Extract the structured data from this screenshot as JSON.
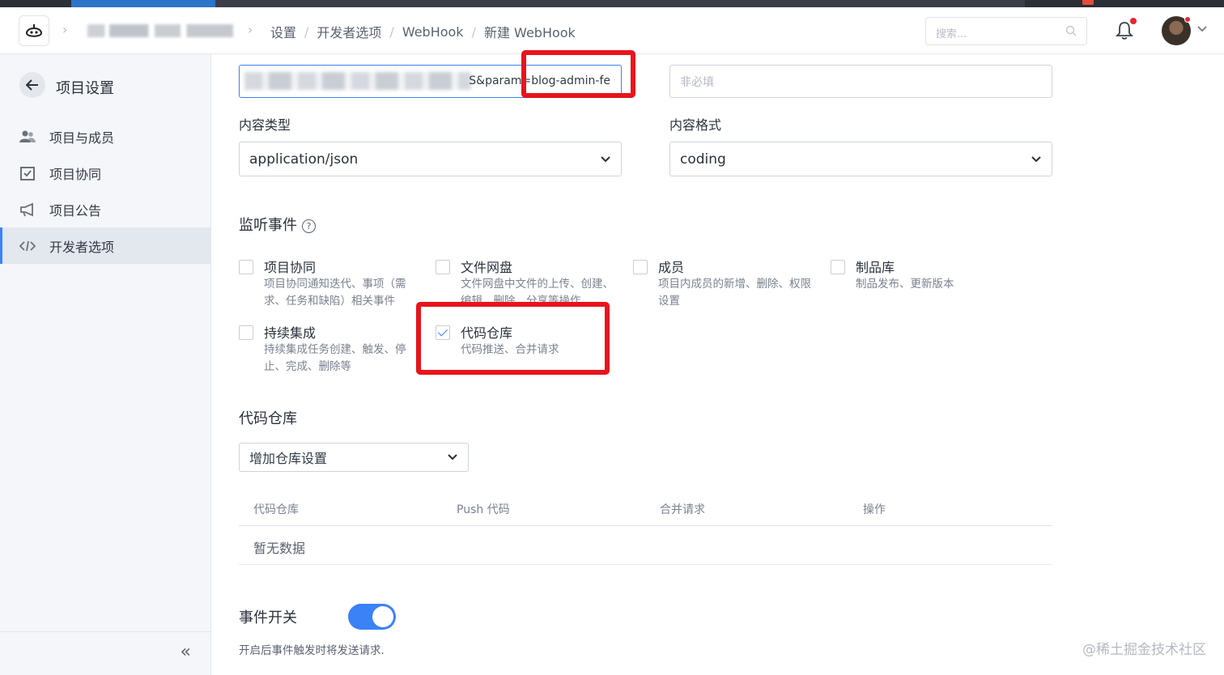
{
  "breadcrumb": [
    "设置",
    "开发者选项",
    "WebHook",
    "新建 WebHook"
  ],
  "header": {
    "search_placeholder": "搜索..."
  },
  "sidebar": {
    "title": "项目设置",
    "items": [
      {
        "label": "项目与成员",
        "icon": "members-icon",
        "active": false
      },
      {
        "label": "项目协同",
        "icon": "task-check-icon",
        "active": false
      },
      {
        "label": "项目公告",
        "icon": "megaphone-icon",
        "active": false
      },
      {
        "label": "开发者选项",
        "icon": "code-icon",
        "active": true
      }
    ],
    "collapse_label": "«"
  },
  "form": {
    "url_value_visible": "S&param=blog-admin-fe",
    "secret_placeholder": "非必填",
    "content_type_label": "内容类型",
    "content_type_value": "application/json",
    "content_format_label": "内容格式",
    "content_format_value": "coding"
  },
  "events": {
    "title": "监听事件",
    "items": [
      {
        "name": "项目协同",
        "desc": "项目协同通知迭代、事项（需求、任务和缺陷）相关事件",
        "checked": false
      },
      {
        "name": "文件网盘",
        "desc": "文件网盘中文件的上传、创建、编辑、删除、分享等操作",
        "checked": false
      },
      {
        "name": "成员",
        "desc": "项目内成员的新增、删除、权限设置",
        "checked": false
      },
      {
        "name": "制品库",
        "desc": "制品发布、更新版本",
        "checked": false
      },
      {
        "name": "持续集成",
        "desc": "持续集成任务创建、触发、停止、完成、删除等",
        "checked": false
      },
      {
        "name": "代码仓库",
        "desc": "代码推送、合并请求",
        "checked": true
      }
    ]
  },
  "repo": {
    "title": "代码仓库",
    "add_select": "增加仓库设置",
    "columns": [
      "代码仓库",
      "Push 代码",
      "合并请求",
      "操作"
    ],
    "empty": "暂无数据"
  },
  "switch": {
    "label": "事件开关",
    "on": true,
    "hint": "开启后事件触发时将发送请求."
  },
  "colors": {
    "accent": "#3b82f6",
    "highlight": "#e8141c"
  },
  "watermark": "@稀土掘金技术社区"
}
